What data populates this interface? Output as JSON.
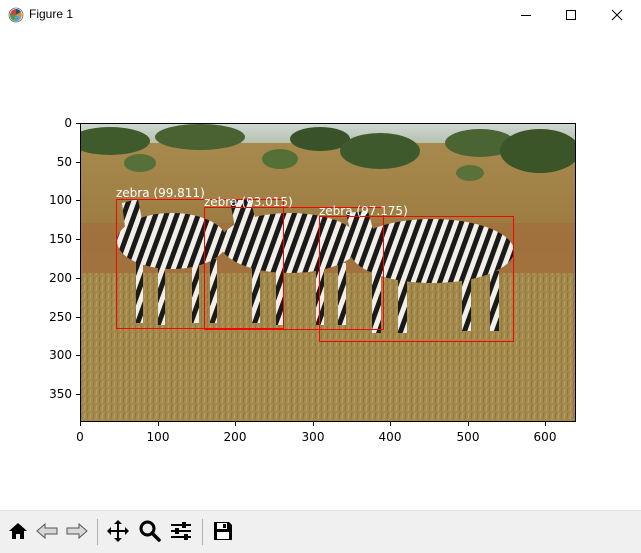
{
  "window": {
    "title": "Figure 1"
  },
  "axes": {
    "yticks": [
      "0",
      "50",
      "100",
      "150",
      "200",
      "250",
      "300",
      "350"
    ],
    "xticks": [
      "0",
      "100",
      "200",
      "300",
      "400",
      "500",
      "600"
    ]
  },
  "detections": [
    {
      "label": "zebra (99.811)"
    },
    {
      "label": "zebra (93.015)"
    },
    {
      "label": "zebra (97.175)"
    }
  ],
  "colors": {
    "box": "#ff0000",
    "label_text": "#ffffff",
    "toolbar_bg": "#f0f0f0"
  },
  "toolbar": {
    "icons": [
      "home-icon",
      "back-icon",
      "forward-icon",
      "pan-icon",
      "zoom-icon",
      "configure-subplots-icon",
      "save-icon"
    ]
  }
}
